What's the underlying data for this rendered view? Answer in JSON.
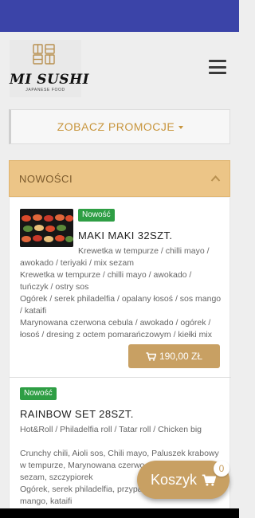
{
  "brand": {
    "name": "MI SUSHI",
    "subtitle": "JAPANESE FOOD"
  },
  "promo": {
    "label": "ZOBACZ PROMOCJE"
  },
  "section": {
    "title": "NOWOŚCI"
  },
  "products": [
    {
      "badge": "Nowość",
      "title": "MAKI MAKI 32SZT.",
      "description": [
        "Krewetka w tempurze / chilli mayo /",
        "awokado / teriyaki / mix sezam",
        "Krewetka w tempurze / chilli mayo / awokado /",
        "tuńczyk / ostry sos",
        "Ogórek / serek philadelfia / opalany łosoś / sos mango",
        "/ kataifi",
        "Marynowana czerwona cebula / awokado / ogórek /",
        "łosoś / dresing z octem pomarańczowym / kiełki mix"
      ],
      "price": "190,00 ZŁ",
      "cart_icon": "shopping-cart-icon"
    },
    {
      "badge": "Nowość",
      "title": "RAINBOW SET 28SZT.",
      "description": [
        "Hot&Roll / Philadelfia roll / Tatar roll / Chicken big",
        "",
        "Crunchy chili, Aioli sos, Chili mayo, Paluszek krabowy",
        "w tempurze, Marynowana czerwo",
        "sezam, szczypiorek",
        "Ogórek, serek philadelfia, przypa",
        "mango, kataifi"
      ]
    }
  ],
  "cart": {
    "label": "Koszyk",
    "count": "0",
    "icon": "shopping-cart-icon"
  },
  "colors": {
    "status_bar": "#3b44a8",
    "accent": "#c8a063",
    "section_head": "#ecc587",
    "badge": "#2e9e44"
  }
}
